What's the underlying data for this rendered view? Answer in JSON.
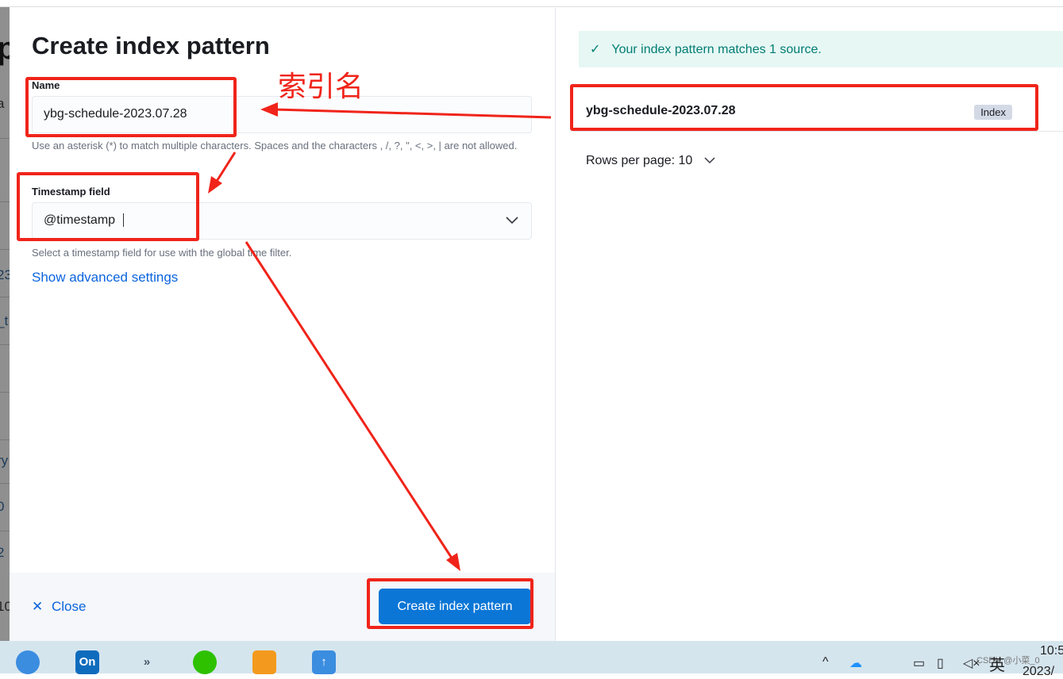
{
  "background_fragments": [
    "p",
    "a",
    "23",
    "_t",
    "ry",
    "0",
    "2",
    "10"
  ],
  "flyout": {
    "title": "Create index pattern",
    "name_label": "Name",
    "name_value": "ybg-schedule-2023.07.28",
    "name_help": "Use an asterisk (*) to match multiple characters. Spaces and the characters , /, ?, \", <, >, | are not allowed.",
    "timestamp_label": "Timestamp field",
    "timestamp_value": "@timestamp",
    "timestamp_help": "Select a timestamp field for use with the global time filter.",
    "advanced_link": "Show advanced settings",
    "close_label": "Close",
    "create_label": "Create index pattern"
  },
  "preview": {
    "callout": "Your index pattern matches 1 source.",
    "rows": [
      {
        "name": "ybg-schedule-2023.07.28",
        "type": "Index"
      }
    ],
    "rows_per_page": "Rows per page: 10"
  },
  "annotation": {
    "text": "索引名",
    "color": "#f0241a"
  },
  "taskbar": {
    "apps": [
      "search-app",
      "On",
      "vscode-like",
      "wechat",
      "vmware",
      "app-arrow"
    ],
    "tray": {
      "ime": "英",
      "time": "10:5",
      "date": "2023/",
      "watermark": "CSDN @小菜_0"
    }
  },
  "colors": {
    "accent": "#0b76d6",
    "success": "#017d73"
  }
}
